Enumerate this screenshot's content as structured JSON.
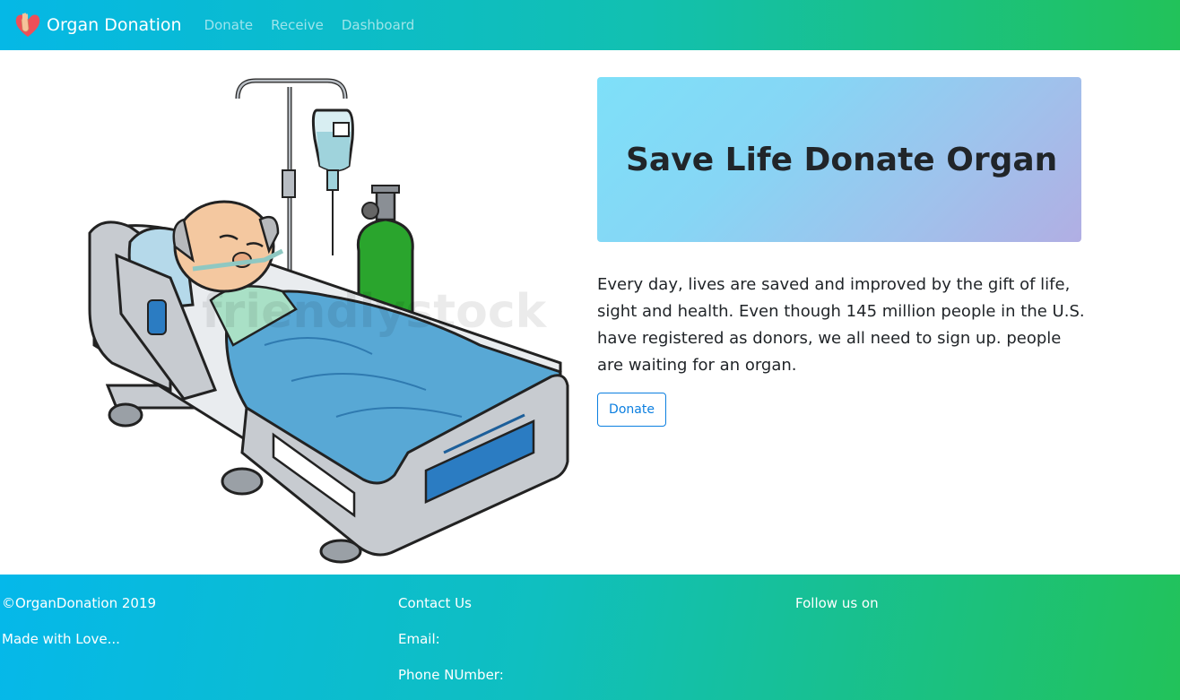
{
  "nav": {
    "brand": "Organ Donation",
    "links": [
      "Donate",
      "Receive",
      "Dashboard"
    ]
  },
  "hero": {
    "title": "Save Life Donate Organ",
    "description": "Every day, lives are saved and improved by the gift of life, sight and health. Even though 145 million people in the U.S. have registered as donors, we all need to sign up. people are waiting for an organ.",
    "button": "Donate",
    "watermark": "friendlystock"
  },
  "footer": {
    "col1": [
      "©OrganDonation 2019",
      "Made with Love..."
    ],
    "col2": [
      "Contact Us",
      "Email:",
      "Phone NUmber:"
    ],
    "col3": [
      "Follow us on"
    ]
  }
}
